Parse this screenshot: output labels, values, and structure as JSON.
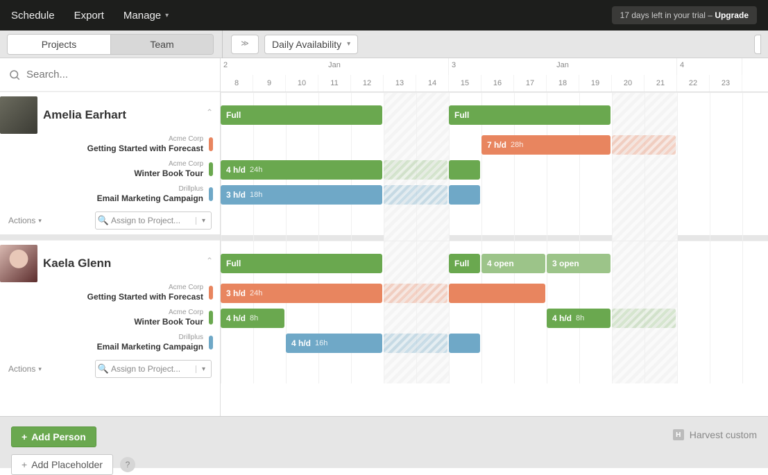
{
  "topnav": {
    "schedule": "Schedule",
    "export": "Export",
    "manage": "Manage"
  },
  "trial": {
    "text": "17 days left in your trial – ",
    "upgrade": "Upgrade"
  },
  "tabs": {
    "projects": "Projects",
    "team": "Team"
  },
  "view_mode": "Daily Availability",
  "search_placeholder": "Search...",
  "timeline": {
    "weeks": [
      {
        "num": "2",
        "month": "Jan",
        "days": [
          "8",
          "9",
          "10",
          "11",
          "12",
          "13",
          "14"
        ]
      },
      {
        "num": "3",
        "month": "Jan",
        "days": [
          "15",
          "16",
          "17",
          "18",
          "19",
          "20",
          "21"
        ]
      },
      {
        "num": "4",
        "month": "",
        "days": [
          "22",
          "23"
        ]
      }
    ]
  },
  "actions_label": "Actions",
  "assign_placeholder": "Assign to Project...",
  "people": [
    {
      "name": "Amelia Earhart",
      "availability": [
        {
          "label": "Full",
          "start": 0,
          "span": 5,
          "style": "green"
        },
        {
          "label": "Full",
          "start": 7,
          "span": 5,
          "style": "green"
        }
      ],
      "assignments": [
        {
          "client": "Acme Corp",
          "project": "Getting Started with Forecast",
          "color": "orange",
          "bars": [
            {
              "label": "7 h/d",
              "sub": "28h",
              "start": 8,
              "span": 4,
              "style": "orange"
            },
            {
              "label": "",
              "sub": "",
              "start": 12,
              "span": 2,
              "style": "ghost-orange"
            }
          ]
        },
        {
          "client": "Acme Corp",
          "project": "Winter Book Tour",
          "color": "green",
          "bars": [
            {
              "label": "4 h/d",
              "sub": "24h",
              "start": 0,
              "span": 5,
              "style": "green"
            },
            {
              "label": "",
              "sub": "",
              "start": 5,
              "span": 2,
              "style": "ghost-green"
            },
            {
              "label": "",
              "sub": "",
              "start": 7,
              "span": 1,
              "style": "green"
            }
          ]
        },
        {
          "client": "Drillplus",
          "project": "Email Marketing Campaign",
          "color": "blue",
          "bars": [
            {
              "label": "3 h/d",
              "sub": "18h",
              "start": 0,
              "span": 5,
              "style": "blue"
            },
            {
              "label": "",
              "sub": "",
              "start": 5,
              "span": 2,
              "style": "ghost-blue"
            },
            {
              "label": "",
              "sub": "",
              "start": 7,
              "span": 1,
              "style": "blue"
            }
          ]
        }
      ]
    },
    {
      "name": "Kaela Glenn",
      "availability": [
        {
          "label": "Full",
          "start": 0,
          "span": 5,
          "style": "green"
        },
        {
          "label": "Full",
          "start": 7,
          "span": 1,
          "style": "green"
        },
        {
          "label": "4 open",
          "start": 8,
          "span": 2,
          "style": "green-light"
        },
        {
          "label": "3 open",
          "start": 10,
          "span": 2,
          "style": "green-light"
        }
      ],
      "assignments": [
        {
          "client": "Acme Corp",
          "project": "Getting Started with Forecast",
          "color": "orange",
          "bars": [
            {
              "label": "3 h/d",
              "sub": "24h",
              "start": 0,
              "span": 5,
              "style": "orange"
            },
            {
              "label": "",
              "sub": "",
              "start": 5,
              "span": 2,
              "style": "ghost-orange"
            },
            {
              "label": "",
              "sub": "",
              "start": 7,
              "span": 3,
              "style": "orange"
            }
          ]
        },
        {
          "client": "Acme Corp",
          "project": "Winter Book Tour",
          "color": "green",
          "bars": [
            {
              "label": "4 h/d",
              "sub": "8h",
              "start": 0,
              "span": 2,
              "style": "green"
            },
            {
              "label": "4 h/d",
              "sub": "8h",
              "start": 10,
              "span": 2,
              "style": "green"
            },
            {
              "label": "",
              "sub": "",
              "start": 12,
              "span": 2,
              "style": "ghost-green"
            }
          ]
        },
        {
          "client": "Drillplus",
          "project": "Email Marketing Campaign",
          "color": "blue",
          "bars": [
            {
              "label": "4 h/d",
              "sub": "16h",
              "start": 2,
              "span": 3,
              "style": "blue"
            },
            {
              "label": "",
              "sub": "",
              "start": 5,
              "span": 2,
              "style": "ghost-blue"
            },
            {
              "label": "",
              "sub": "",
              "start": 7,
              "span": 1,
              "style": "blue"
            }
          ]
        }
      ]
    }
  ],
  "footer": {
    "add_person": "Add Person",
    "add_placeholder": "Add Placeholder",
    "harvest": "Harvest custom"
  }
}
